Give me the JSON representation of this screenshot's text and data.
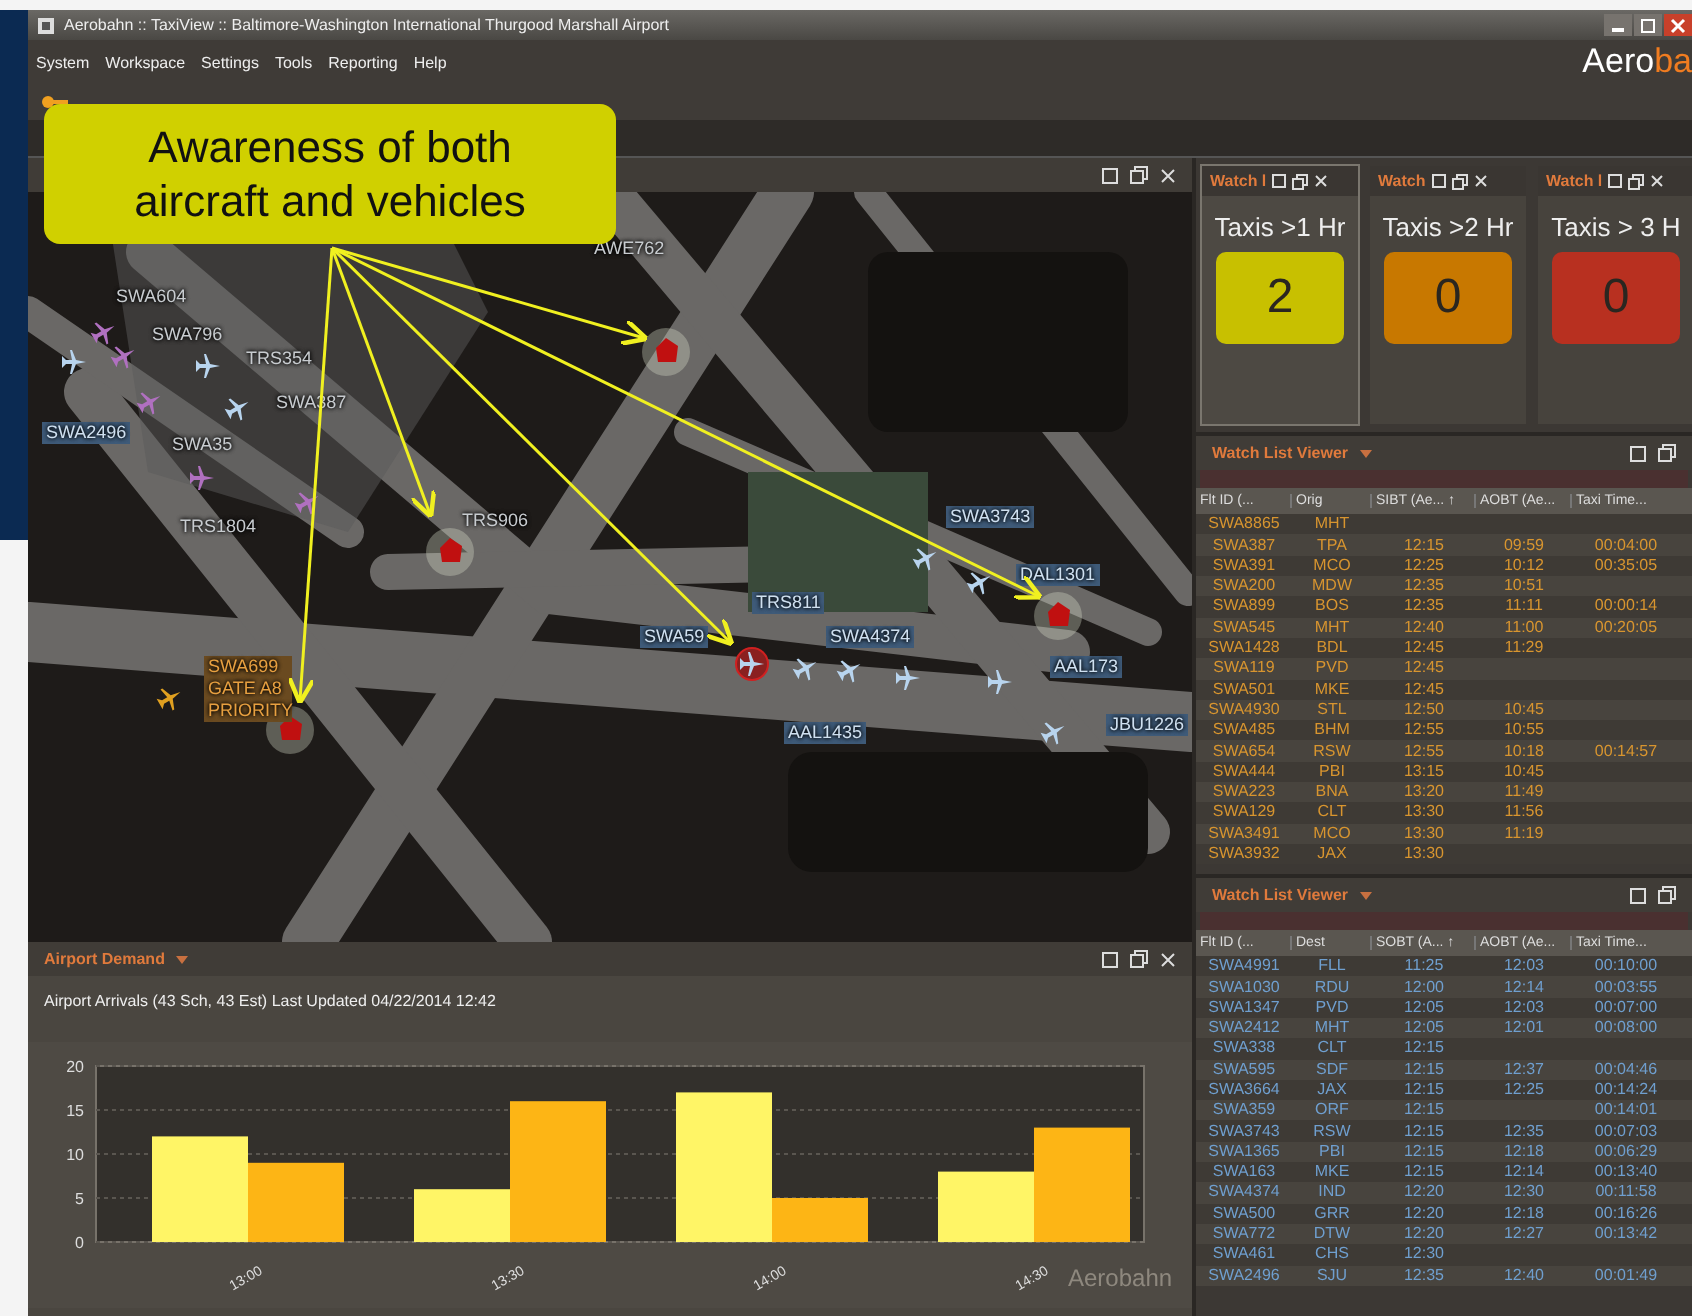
{
  "window": {
    "title": "Aerobahn :: TaxiView :: Baltimore-Washington International Thurgood Marshall Airport"
  },
  "logo": {
    "part_1": "Aero",
    "part_2": "ba"
  },
  "menu": [
    "System",
    "Workspace",
    "Settings",
    "Tools",
    "Reporting",
    "Help"
  ],
  "callout": {
    "text": "Awareness of both aircraft and vehicles"
  },
  "map": {
    "labels": [
      {
        "text": "AWE762",
        "kind": "plain"
      },
      {
        "text": "SWA604",
        "kind": "plain"
      },
      {
        "text": "SWA796",
        "kind": "plain"
      },
      {
        "text": "TRS354",
        "kind": "plain"
      },
      {
        "text": "SWA387",
        "kind": "plain"
      },
      {
        "text": "SWA2496",
        "kind": "tagged"
      },
      {
        "text": "SWA35",
        "kind": "plain"
      },
      {
        "text": "TRS1804",
        "kind": "plain"
      },
      {
        "text": "TRS906",
        "kind": "plain"
      },
      {
        "text": "SWA3743",
        "kind": "tagged"
      },
      {
        "text": "DAL1301",
        "kind": "tagged"
      },
      {
        "text": "TRS811",
        "kind": "tagged"
      },
      {
        "text": "SWA59",
        "kind": "tagged"
      },
      {
        "text": "SWA4374",
        "kind": "tagged"
      },
      {
        "text": "AAL173",
        "kind": "tagged"
      },
      {
        "text": "AAL1435",
        "kind": "tagged"
      },
      {
        "text": "JBU1226",
        "kind": "tagged"
      },
      {
        "text": "SWA699 GATE A8 PRIORITY",
        "kind": "priority"
      }
    ]
  },
  "watch_tiles": [
    {
      "tab": "Watch l",
      "title": "Taxis >1 Hr",
      "count": "2",
      "color": "#c8c000",
      "selected": true
    },
    {
      "tab": "Watch",
      "title": "Taxis >2 Hr",
      "count": "0",
      "color": "#c87800",
      "selected": false
    },
    {
      "tab": "Watch l",
      "title": "Taxis > 3 H",
      "count": "0",
      "color": "#b83020",
      "selected": false
    }
  ],
  "watch_lists": [
    {
      "title": "Watch List Viewer",
      "kind": "inbound",
      "columns": [
        "Flt ID (...",
        "Orig",
        "SIBT (Ae... ↑",
        "AOBT (Ae...",
        "Taxi Time..."
      ],
      "rows": [
        [
          "SWA8865",
          "MHT",
          "",
          "",
          ""
        ],
        [
          "SWA387",
          "TPA",
          "12:15",
          "09:59",
          "00:04:00"
        ],
        [
          "SWA391",
          "MCO",
          "12:25",
          "10:12",
          "00:35:05"
        ],
        [
          "SWA200",
          "MDW",
          "12:35",
          "10:51",
          ""
        ],
        [
          "SWA899",
          "BOS",
          "12:35",
          "11:11",
          "00:00:14"
        ],
        [
          "SWA545",
          "MHT",
          "12:40",
          "11:00",
          "00:20:05"
        ],
        [
          "SWA1428",
          "BDL",
          "12:45",
          "11:29",
          ""
        ],
        [
          "SWA119",
          "PVD",
          "12:45",
          "",
          ""
        ],
        [
          "SWA501",
          "MKE",
          "12:45",
          "",
          ""
        ],
        [
          "SWA4930",
          "STL",
          "12:50",
          "10:45",
          ""
        ],
        [
          "SWA485",
          "BHM",
          "12:55",
          "10:55",
          ""
        ],
        [
          "SWA654",
          "RSW",
          "12:55",
          "10:18",
          "00:14:57"
        ],
        [
          "SWA444",
          "PBI",
          "13:15",
          "10:45",
          ""
        ],
        [
          "SWA223",
          "BNA",
          "13:20",
          "11:49",
          ""
        ],
        [
          "SWA129",
          "CLT",
          "13:30",
          "11:56",
          ""
        ],
        [
          "SWA3491",
          "MCO",
          "13:30",
          "11:19",
          ""
        ],
        [
          "SWA3932",
          "JAX",
          "13:30",
          "",
          ""
        ]
      ]
    },
    {
      "title": "Watch List Viewer",
      "kind": "outbound",
      "columns": [
        "Flt ID (...",
        "Dest",
        "SOBT (A... ↑",
        "AOBT (Ae...",
        "Taxi Time..."
      ],
      "rows": [
        [
          "SWA4991",
          "FLL",
          "11:25",
          "12:03",
          "00:10:00"
        ],
        [
          "SWA1030",
          "RDU",
          "12:00",
          "12:14",
          "00:03:55"
        ],
        [
          "SWA1347",
          "PVD",
          "12:05",
          "12:03",
          "00:07:00"
        ],
        [
          "SWA2412",
          "MHT",
          "12:05",
          "12:01",
          "00:08:00"
        ],
        [
          "SWA338",
          "CLT",
          "12:15",
          "",
          ""
        ],
        [
          "SWA595",
          "SDF",
          "12:15",
          "12:37",
          "00:04:46"
        ],
        [
          "SWA3664",
          "JAX",
          "12:15",
          "12:25",
          "00:14:24"
        ],
        [
          "SWA359",
          "ORF",
          "12:15",
          "",
          "00:14:01"
        ],
        [
          "SWA3743",
          "RSW",
          "12:15",
          "12:35",
          "00:07:03"
        ],
        [
          "SWA1365",
          "PBI",
          "12:15",
          "12:18",
          "00:06:29"
        ],
        [
          "SWA163",
          "MKE",
          "12:15",
          "12:14",
          "00:13:40"
        ],
        [
          "SWA4374",
          "IND",
          "12:20",
          "12:30",
          "00:11:58"
        ],
        [
          "SWA500",
          "GRR",
          "12:20",
          "12:18",
          "00:16:26"
        ],
        [
          "SWA772",
          "DTW",
          "12:20",
          "12:27",
          "00:13:42"
        ],
        [
          "SWA461",
          "CHS",
          "12:30",
          "",
          ""
        ],
        [
          "SWA2496",
          "SJU",
          "12:35",
          "12:40",
          "00:01:49"
        ]
      ]
    }
  ],
  "airport_demand": {
    "title": "Airport Demand",
    "info": "Airport Arrivals (43  Sch, 43 Est)  Last Updated 04/22/2014 12:42",
    "watermark": "Aerobahn",
    "chart_data": {
      "type": "bar",
      "categories": [
        "13:00",
        "13:30",
        "14:00",
        "14:30"
      ],
      "series": [
        {
          "color": "#fff566",
          "values": [
            12,
            6,
            17,
            8
          ]
        },
        {
          "color": "#fdb515",
          "values": [
            9,
            16,
            5,
            13
          ]
        }
      ],
      "ylim": [
        0,
        20
      ],
      "yticks": [
        0,
        5,
        10,
        15,
        20
      ],
      "grid": true
    }
  }
}
